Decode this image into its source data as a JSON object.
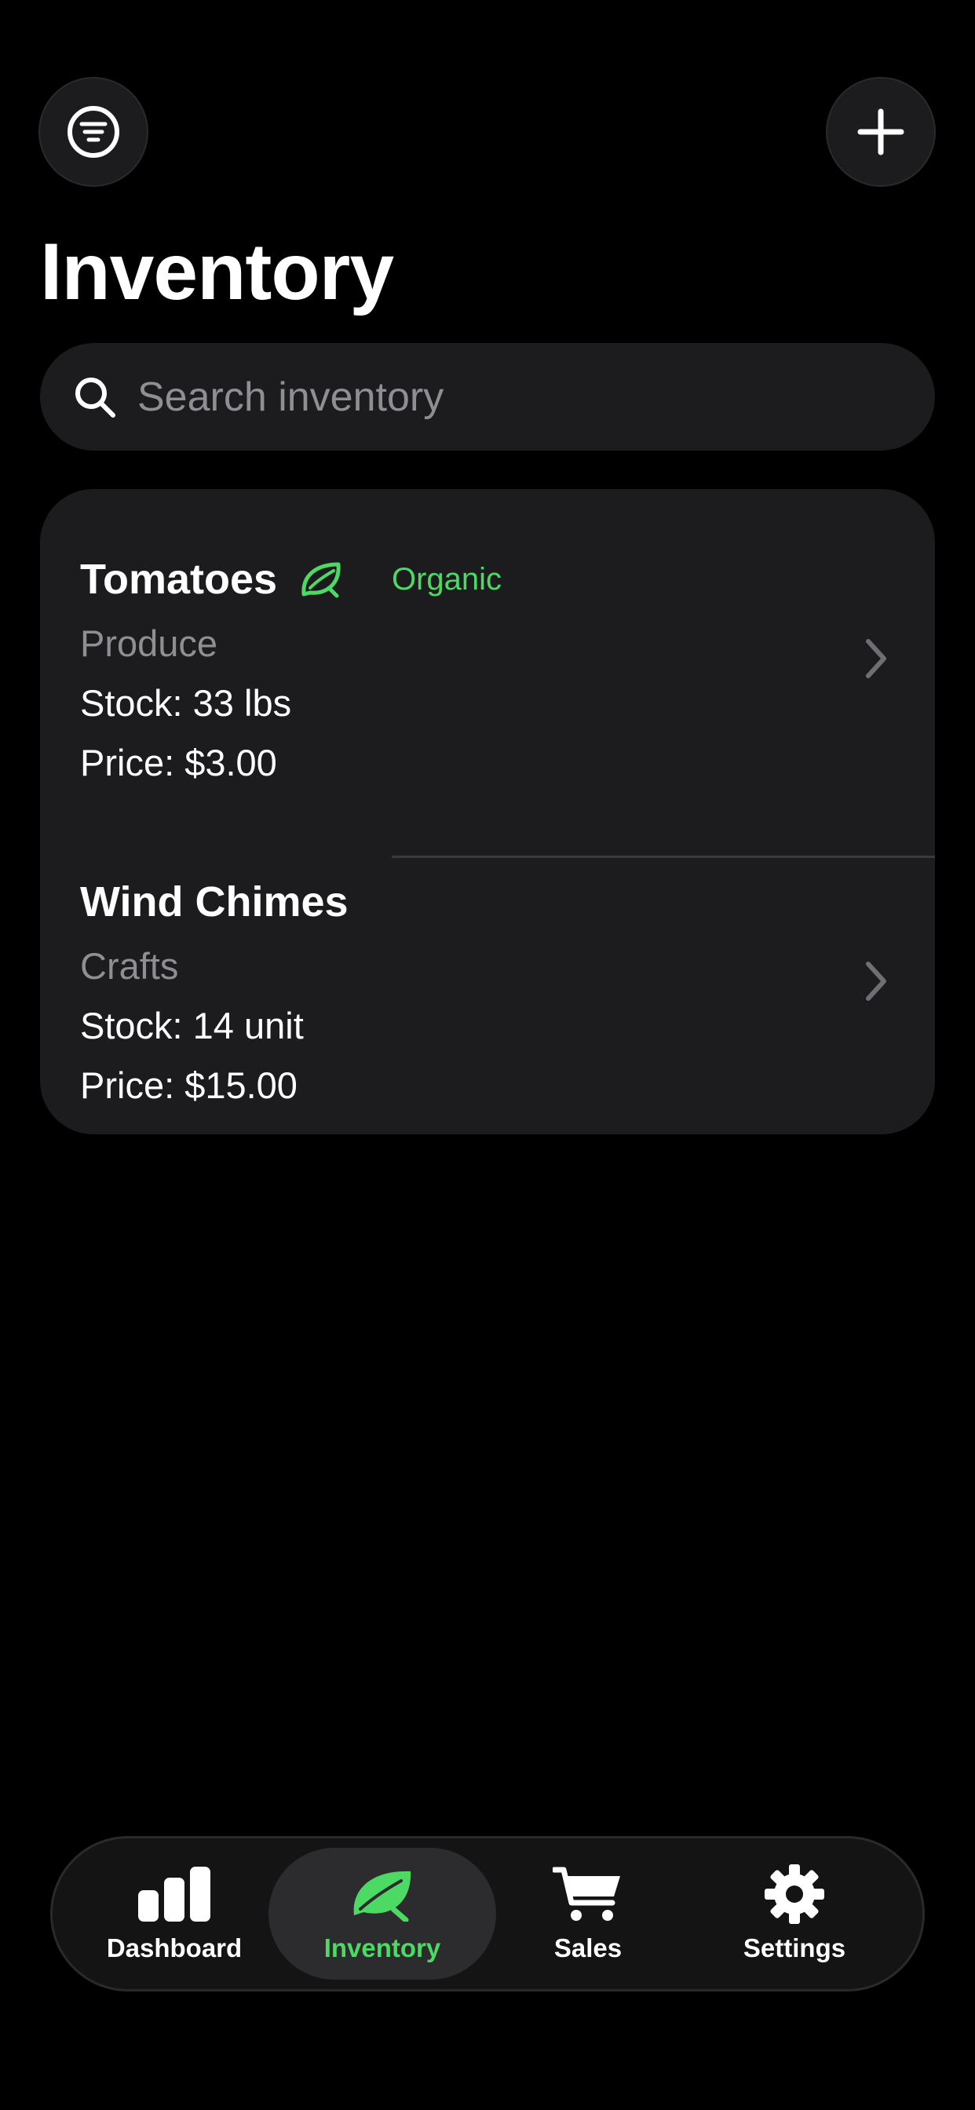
{
  "header": {
    "title": "Inventory",
    "filter_icon": "filter-lines-icon",
    "add_icon": "plus-icon"
  },
  "search": {
    "placeholder": "Search inventory",
    "value": "",
    "icon": "search-icon"
  },
  "items": [
    {
      "name": "Tomatoes",
      "badge_icon": "leaf-icon",
      "badge_label": "Organic",
      "category": "Produce",
      "stock": "Stock: 33 lbs",
      "price": "Price: $3.00"
    },
    {
      "name": "Wind Chimes",
      "category": "Crafts",
      "stock": "Stock: 14 unit",
      "price": "Price: $15.00"
    }
  ],
  "tabbar": {
    "active": "Inventory",
    "tabs": [
      {
        "label": "Dashboard",
        "icon": "bar-chart-icon"
      },
      {
        "label": "Inventory",
        "icon": "leaf-icon"
      },
      {
        "label": "Sales",
        "icon": "cart-icon"
      },
      {
        "label": "Settings",
        "icon": "gear-icon"
      }
    ]
  },
  "colors": {
    "background": "#000000",
    "surface": "#1c1c1e",
    "accent": "#4cd964",
    "secondary_text": "#8e8e93",
    "active_tab": "#2c2c2e"
  }
}
